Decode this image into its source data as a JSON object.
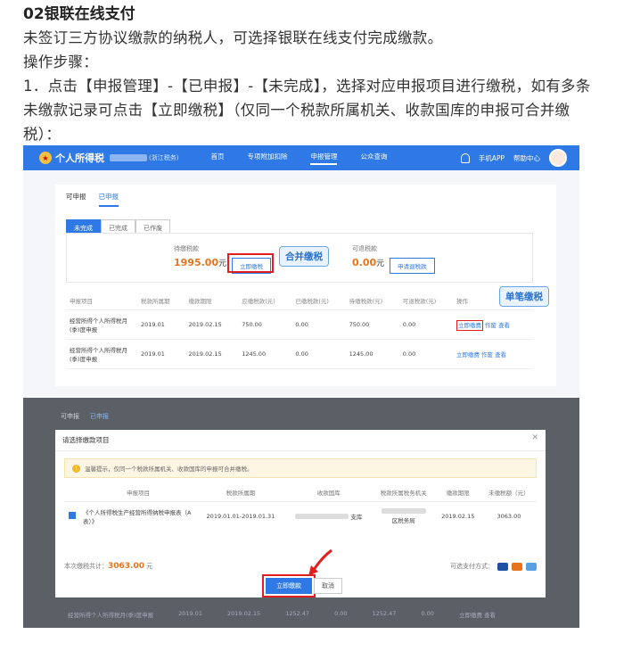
{
  "article": {
    "heading": "02银联在线支付",
    "line1": "未签订三方协议缴款的纳税人，可选择银联在线支付完成缴款。",
    "line2": "操作步骤：",
    "line3": "1．点击【申报管理】-【已申报】-【未完成】，选择对应申报项目进行缴税，如有多条",
    "line4": "未缴款记录可点击【立即缴税】（仅同一个税款所属机关、收款国库的申报可合并缴",
    "line5": "税）："
  },
  "shot1": {
    "brand": "个人所得税",
    "org": "(浙江税务)",
    "nav": [
      "首页",
      "专项附加扣除",
      "申报管理",
      "公众查询"
    ],
    "right_links": [
      "手机APP",
      "帮助中心"
    ],
    "tabs": [
      "可申报",
      "已申报"
    ],
    "subtabs": [
      "未完成",
      "已完成",
      "已作废"
    ],
    "summary": {
      "due_label": "待缴税款",
      "due_amount": "1995.00",
      "unit": "元",
      "pay_now": "立即缴税",
      "merge_callout": "合并缴税",
      "refund_label": "可退税款",
      "refund_amount": "0.00",
      "refund_button": "申请退税款"
    },
    "table": {
      "headers": [
        "申报项目",
        "税款所属期",
        "缴款期限",
        "应缴税款(元)",
        "已缴税款(元)",
        "待缴税款(元)",
        "可退税款(元)",
        "操作"
      ],
      "rows": [
        {
          "item": "经营所得个人所得税月(季)度申报",
          "period": "2019.01",
          "deadline": "2019.02.15",
          "payable": "750.00",
          "paid": "0.00",
          "due": "750.00",
          "refundable": "0.00",
          "ops": [
            "立即缴费",
            "作废",
            "查看"
          ]
        },
        {
          "item": "经营所得个人所得税月(季)度申报",
          "period": "2019.01",
          "deadline": "2019.02.15",
          "payable": "1245.00",
          "paid": "0.00",
          "due": "1245.00",
          "refundable": "0.00",
          "ops": [
            "立即缴费",
            "作废",
            "查看"
          ]
        }
      ]
    },
    "single_callout": "单笔缴税"
  },
  "shot2": {
    "bg_tabs": [
      "可申报",
      "已申报"
    ],
    "dialog_title": "请选择缴款项目",
    "warning": "温馨提示，仅同一个税款所属机关、收款国库的申报可合并缴税。",
    "headers": [
      "申报项目",
      "税款所属期",
      "收款国库",
      "税款所属税务机关",
      "缴款期限",
      "未缴税额（元）"
    ],
    "row": {
      "item": "《个人所得税生产经营所得纳税申报表（A表）》",
      "period": "2019.01.01-2019.01.31",
      "treasury_tail": "支库",
      "authority_tail": "区税务局",
      "deadline": "2019.02.15",
      "amount": "3063.00"
    },
    "total_label": "本次缴税共计：",
    "total_amount": "3063.00",
    "total_unit": "元",
    "pay_methods_label": "可选支付方式：",
    "confirm_button": "立即缴款",
    "cancel_button": "取消",
    "bg_row": {
      "item": "经营所得个人所得税月(季)度申报",
      "period": "2019.01",
      "deadline": "2019.02.15",
      "payable": "1252.47",
      "paid": "0.00",
      "due": "1252.47",
      "refundable": "0.00",
      "ops": "立即缴费 查看"
    }
  }
}
